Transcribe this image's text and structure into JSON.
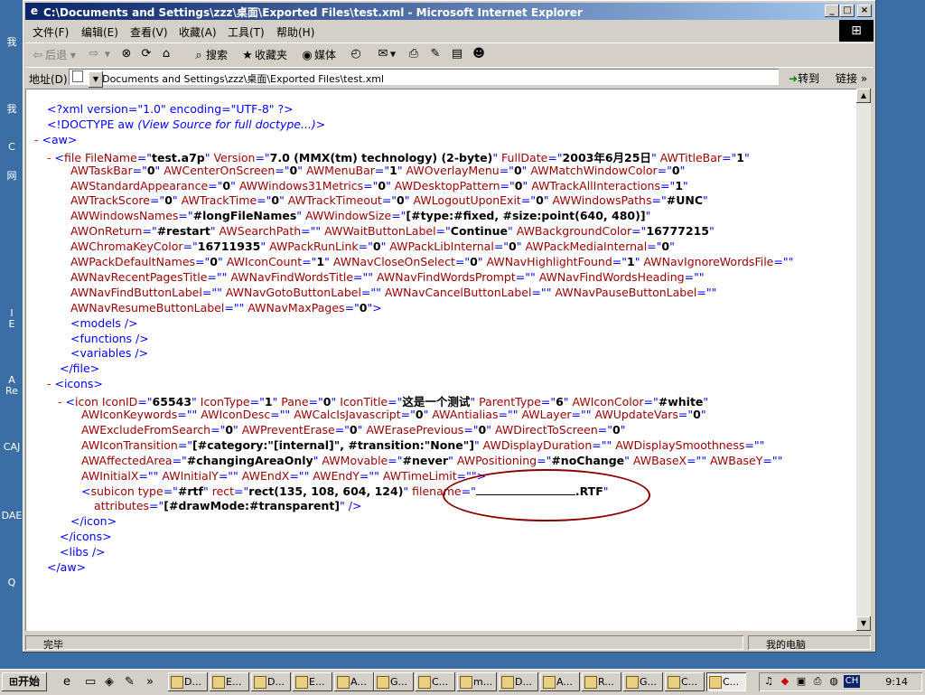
{
  "desktop": {
    "labels": [
      "我",
      "我",
      "C",
      "网",
      "I",
      "E",
      "A",
      "Re",
      "CAJ",
      "DAE",
      "Q"
    ]
  },
  "window": {
    "title": "C:\\Documents and Settings\\zzz\\桌面\\Exported Files\\test.xml - Microsoft Internet Explorer",
    "minimize": "_",
    "maximize": "□",
    "close": "×"
  },
  "menu": [
    "文件(F)",
    "编辑(E)",
    "查看(V)",
    "收藏(A)",
    "工具(T)",
    "帮助(H)"
  ],
  "toolbar": {
    "back": "后退",
    "search": "搜索",
    "favorites": "收藏夹",
    "media": "媒体"
  },
  "address": {
    "label": "地址(D)",
    "value": "C:\\Documents and Settings\\zzz\\桌面\\Exported Files\\test.xml",
    "go": "转到",
    "links": "链接 »"
  },
  "xml": {
    "l1": "<?xml version=\"1.0\" encoding=\"UTF-8\" ?>",
    "l2a": "<!DOCTYPE aw ",
    "l2b": "(View Source for full doctype...)",
    "l2c": ">",
    "aw_open": "<aw>",
    "file_attrs": [
      [
        "FileName",
        "test.a7p"
      ],
      [
        "Version",
        "7.0 (MMX(tm) technology) (2-byte)"
      ],
      [
        "FullDate",
        "2003年6月25日"
      ],
      [
        "AWTitleBar",
        "1"
      ]
    ],
    "file_lines": [
      [
        [
          "AWTaskBar",
          "0"
        ],
        [
          "AWCenterOnScreen",
          "0"
        ],
        [
          "AWMenuBar",
          "1"
        ],
        [
          "AWOverlayMenu",
          "0"
        ],
        [
          "AWMatchWindowColor",
          "0"
        ]
      ],
      [
        [
          "AWStandardAppearance",
          "0"
        ],
        [
          "AWWindows31Metrics",
          "0"
        ],
        [
          "AWDesktopPattern",
          "0"
        ],
        [
          "AWTrackAllInteractions",
          "1"
        ]
      ],
      [
        [
          "AWTrackScore",
          "0"
        ],
        [
          "AWTrackTime",
          "0"
        ],
        [
          "AWTrackTimeout",
          "0"
        ],
        [
          "AWLogoutUponExit",
          "0"
        ],
        [
          "AWWindowsPaths",
          "#UNC"
        ]
      ],
      [
        [
          "AWWindowsNames",
          "#longFileNames"
        ],
        [
          "AWWindowSize",
          "[#type:#fixed, #size:point(640, 480)]"
        ]
      ],
      [
        [
          "AWOnReturn",
          "#restart"
        ],
        [
          "AWSearchPath",
          ""
        ],
        [
          "AWWaitButtonLabel",
          "Continue"
        ],
        [
          "AWBackgroundColor",
          "16777215"
        ]
      ],
      [
        [
          "AWChromaKeyColor",
          "16711935"
        ],
        [
          "AWPackRunLink",
          "0"
        ],
        [
          "AWPackLibInternal",
          "0"
        ],
        [
          "AWPackMediaInternal",
          "0"
        ]
      ],
      [
        [
          "AWPackDefaultNames",
          "0"
        ],
        [
          "AWIconCount",
          "1"
        ],
        [
          "AWNavCloseOnSelect",
          "0"
        ],
        [
          "AWNavHighlightFound",
          "1"
        ],
        [
          "AWNavIgnoreWordsFile",
          ""
        ]
      ],
      [
        [
          "AWNavRecentPagesTitle",
          ""
        ],
        [
          "AWNavFindWordsTitle",
          ""
        ],
        [
          "AWNavFindWordsPrompt",
          ""
        ],
        [
          "AWNavFindWordsHeading",
          ""
        ]
      ],
      [
        [
          "AWNavFindButtonLabel",
          ""
        ],
        [
          "AWNavGotoButtonLabel",
          ""
        ],
        [
          "AWNavCancelButtonLabel",
          ""
        ],
        [
          "AWNavPauseButtonLabel",
          ""
        ]
      ],
      [
        [
          "AWNavResumeButtonLabel",
          ""
        ],
        [
          "AWNavMaxPages",
          "0"
        ]
      ]
    ],
    "models": "<models />",
    "functions": "<functions />",
    "variables": "<variables />",
    "file_close": "</file>",
    "icons_open": "<icons>",
    "icon_attrs": [
      [
        "IconID",
        "65543"
      ],
      [
        "IconType",
        "1"
      ],
      [
        "Pane",
        "0"
      ],
      [
        "IconTitle",
        "这是一个测试"
      ],
      [
        "ParentType",
        "6"
      ],
      [
        "AWIconColor",
        "#white"
      ]
    ],
    "icon_lines": [
      [
        [
          "AWIconKeywords",
          ""
        ],
        [
          "AWIconDesc",
          ""
        ],
        [
          "AWCalcIsJavascript",
          "0"
        ],
        [
          "AWAntialias",
          ""
        ],
        [
          "AWLayer",
          ""
        ],
        [
          "AWUpdateVars",
          "0"
        ]
      ],
      [
        [
          "AWExcludeFromSearch",
          "0"
        ],
        [
          "AWPreventErase",
          "0"
        ],
        [
          "AWErasePrevious",
          "0"
        ],
        [
          "AWDirectToScreen",
          "0"
        ]
      ],
      [
        [
          "AWIconTransition",
          "[#category:\"[internal]\", #transition:\"None\"]"
        ],
        [
          "AWDisplayDuration",
          ""
        ],
        [
          "AWDisplaySmoothness",
          ""
        ]
      ],
      [
        [
          "AWAffectedArea",
          "#changingAreaOnly"
        ],
        [
          "AWMovable",
          "#never"
        ],
        [
          "AWPositioning",
          "#noChange"
        ],
        [
          "AWBaseX",
          ""
        ],
        [
          "AWBaseY",
          ""
        ]
      ],
      [
        [
          "AWInitialX",
          ""
        ],
        [
          "AWInitialY",
          ""
        ],
        [
          "AWEndX",
          ""
        ],
        [
          "AWEndY",
          ""
        ],
        [
          "AWTimeLimit",
          ""
        ]
      ]
    ],
    "subicon_type": "#rtf",
    "subicon_rect": "rect(135, 108, 604, 124)",
    "subicon_filename_suffix": ".RTF",
    "subicon_attributes": "[#drawMode:#transparent]",
    "icon_close": "</icon>",
    "icons_close": "</icons>",
    "libs": "<libs />",
    "aw_close": "</aw>"
  },
  "status": {
    "left": "完毕",
    "right": "我的电脑"
  },
  "taskbar": {
    "start": "开始",
    "tasks": [
      "D...",
      "E...",
      "D...",
      "E...",
      "A...",
      "G...",
      "C...",
      "m...",
      "D...",
      "A...",
      "R...",
      "G...",
      "C...",
      "C..."
    ],
    "lang": "CH",
    "clock": "9:14"
  }
}
